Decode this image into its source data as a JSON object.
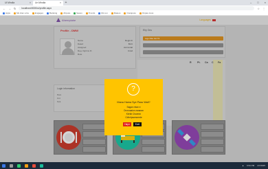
{
  "browser": {
    "tabs": [
      {
        "label": "Ul Mindla"
      },
      {
        "label": "Un Mindla"
      }
    ],
    "new_tab_symbol": "+",
    "window_controls": [
      "–",
      "□",
      "×"
    ],
    "address": "localhost:8000/ui/profile.aspx",
    "bookmarks": [
      "Apps",
      "Ms tirac a ba",
      "Engages",
      "Banking",
      "Ahpura",
      "Saves",
      "Trends",
      "Ms ren",
      "Raleos",
      "Ooraposs",
      "Onpas Jous"
    ]
  },
  "header": {
    "logo_text": "Ahemplahe",
    "right_text": "Languages"
  },
  "profile": {
    "section_title": "Profile - DMW",
    "info": [
      {
        "k": "Name",
        "v": "Rogin ib"
      },
      {
        "k": "Dated",
        "v": "Bd tt"
      },
      {
        "k": "Assigned",
        "v": "Accnvntal"
      },
      {
        "k": "Reg. Ogrtms Fl.",
        "v": "Cnsd"
      },
      {
        "k": "Rote",
        "v": ""
      },
      {
        "k": "Skill",
        "v": ""
      }
    ]
  },
  "personal": {
    "label": "Login information",
    "rows": [
      "Pers",
      "Cnt",
      "Smt"
    ]
  },
  "right_panel": {
    "title": "Elry Ons",
    "selected_label": "Ltgo Rtto Gtt Ttl"
  },
  "table": {
    "headers": [
      "R",
      "Pt.",
      "Ca",
      "C",
      "Fa"
    ]
  },
  "modal": {
    "icon": "?",
    "title": "Mana Hama Sye Pass Wall?",
    "lines": [
      "Sagan rntan e",
      "Orcnoaaion zanaran",
      "Kbrtkt Charenn",
      "Cdhelpsamorede"
    ],
    "no_label": "Hayır",
    "yes_label": "Evet"
  },
  "tiles": [
    {
      "icon": "dining-icon",
      "color": "#c0392b"
    },
    {
      "icon": "bed-icon",
      "color": "#1abc9c"
    },
    {
      "icon": "satellite-icon",
      "color": "#8e44ad"
    }
  ],
  "taskbar": {
    "clock": "6:54 PM",
    "date": "2/7/2025"
  }
}
